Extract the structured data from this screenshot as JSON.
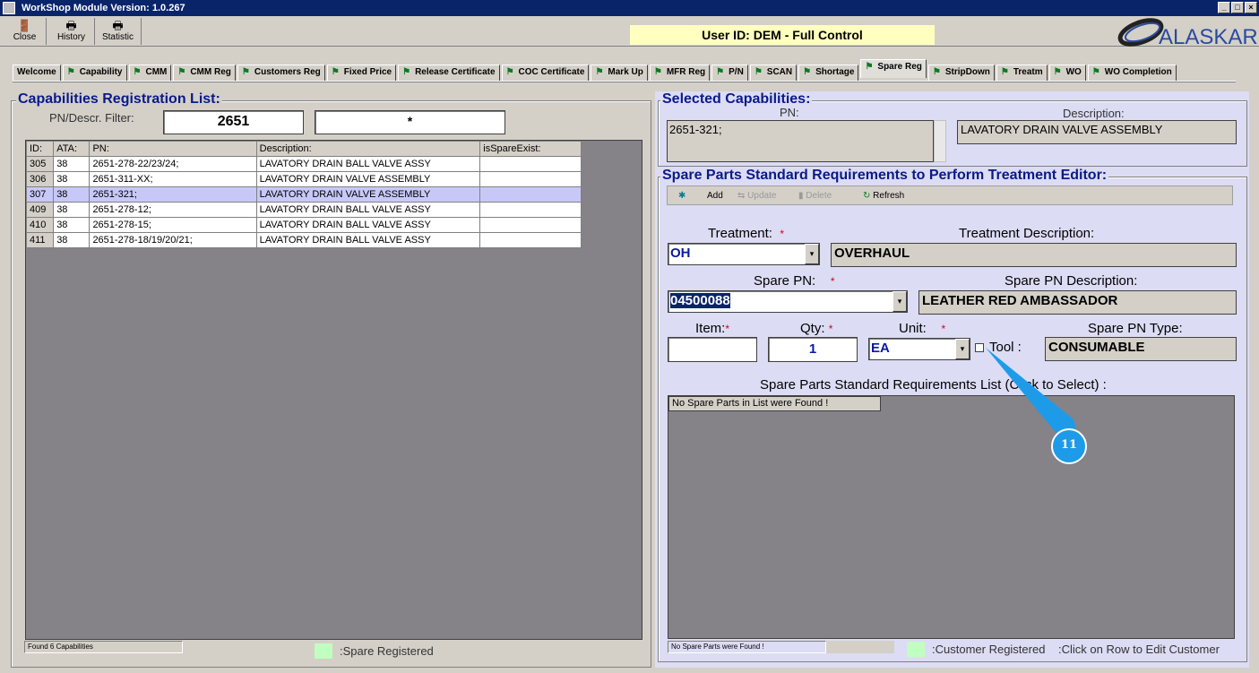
{
  "window": {
    "title": "WorkShop Module  Version: 1.0.267",
    "minimize": "_",
    "restore": "□",
    "close": "×"
  },
  "toolbar": {
    "buttons": [
      {
        "label": "Close",
        "icon": "door-exit-icon"
      },
      {
        "label": "History",
        "icon": "printer-icon"
      },
      {
        "label": "Statistic",
        "icon": "printer-icon"
      }
    ],
    "user_id": "User ID: DEM - Full Control",
    "logo": "ALASKAR"
  },
  "tabs": [
    "Welcome",
    "Capability",
    "CMM",
    "CMM Reg",
    "Customers Reg",
    "Fixed Price",
    "Release Certificate",
    "COC Certificate",
    "Mark Up",
    "MFR Reg",
    "P/N",
    "SCAN",
    "Shortage",
    "Spare Reg",
    "StripDown",
    "Treatm",
    "WO",
    "WO Completion"
  ],
  "selected_tab": "Spare Reg",
  "left": {
    "title": "Capabilities Registration List:",
    "filter_label": "PN/Descr. Filter:",
    "filter_value": "2651",
    "filter_value2": "*",
    "columns": [
      "ID:",
      "ATA:",
      "PN:",
      "Description:",
      "isSpareExist:"
    ],
    "rows": [
      [
        "305",
        "38",
        "2651-278-22/23/24;",
        "LAVATORY DRAIN BALL VALVE ASSY",
        ""
      ],
      [
        "306",
        "38",
        "2651-311-XX;",
        "LAVATORY DRAIN VALVE ASSEMBLY",
        ""
      ],
      [
        "307",
        "38",
        "2651-321;",
        "LAVATORY DRAIN VALVE ASSEMBLY",
        ""
      ],
      [
        "409",
        "38",
        "2651-278-12;",
        "LAVATORY DRAIN BALL VALVE ASSY",
        ""
      ],
      [
        "410",
        "38",
        "2651-278-15;",
        "LAVATORY DRAIN BALL VALVE ASSY",
        ""
      ],
      [
        "411",
        "38",
        "2651-278-18/19/20/21;",
        "LAVATORY DRAIN BALL VALVE ASSY",
        ""
      ]
    ],
    "selected_row": "307",
    "status": "Found 6 Capabilities",
    "legend": ":Spare Registered",
    "legend_color": "#c0ffc0"
  },
  "selected": {
    "title": "Selected Capabilities:",
    "pn_label": "PN:",
    "pn_value": "2651-321;",
    "desc_label": "Description:",
    "desc_value": "LAVATORY DRAIN VALVE ASSEMBLY"
  },
  "editor": {
    "title": "Spare Parts Standard Requirements to Perform Treatment Editor:",
    "actions": {
      "add": "Add",
      "update": "Update",
      "delete": "Delete",
      "refresh": "Refresh"
    },
    "treatment_label": "Treatment:",
    "treatment_value": "OH",
    "treatment_desc_label": "Treatment Description:",
    "treatment_desc_value": "OVERHAUL",
    "spare_pn_label": "Spare PN:",
    "spare_pn_value": "04500088",
    "spare_pn_desc_label": "Spare PN Description:",
    "spare_pn_desc_value": "LEATHER RED AMBASSADOR",
    "item_label": "Item:",
    "item_value": "",
    "qty_label": "Qty:",
    "qty_value": "1",
    "unit_label": "Unit:",
    "unit_value": "EA",
    "tool_label": "Tool :",
    "tool_checked": false,
    "type_label": "Spare PN Type:",
    "type_value": "CONSUMABLE",
    "required_mark": "*",
    "list_label": "Spare Parts Standard Requirements List (Click to Select) :",
    "list_empty": "No Spare Parts in List were Found !",
    "status": "No Spare Parts were Found !",
    "legend": ":Customer Registered",
    "hint": ":Click on Row to Edit Customer",
    "legend_color": "#c0ffc0"
  },
  "annotation": {
    "label": "11",
    "color": "#1e9be8"
  }
}
